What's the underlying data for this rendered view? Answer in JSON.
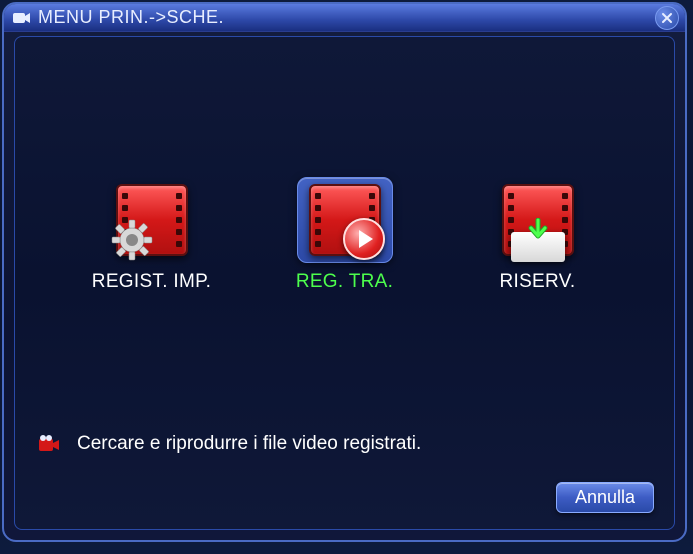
{
  "titlebar": {
    "title": "MENU PRIN.->SCHE."
  },
  "menu": {
    "items": [
      {
        "label": "REGIST. IMP.",
        "selected": false,
        "overlay": "gear"
      },
      {
        "label": "REG. TRA.",
        "selected": true,
        "overlay": "play"
      },
      {
        "label": "RISERV.",
        "selected": false,
        "overlay": "box"
      }
    ]
  },
  "description": {
    "text": "Cercare e riprodurre i file video registrati."
  },
  "footer": {
    "cancel_label": "Annulla"
  }
}
